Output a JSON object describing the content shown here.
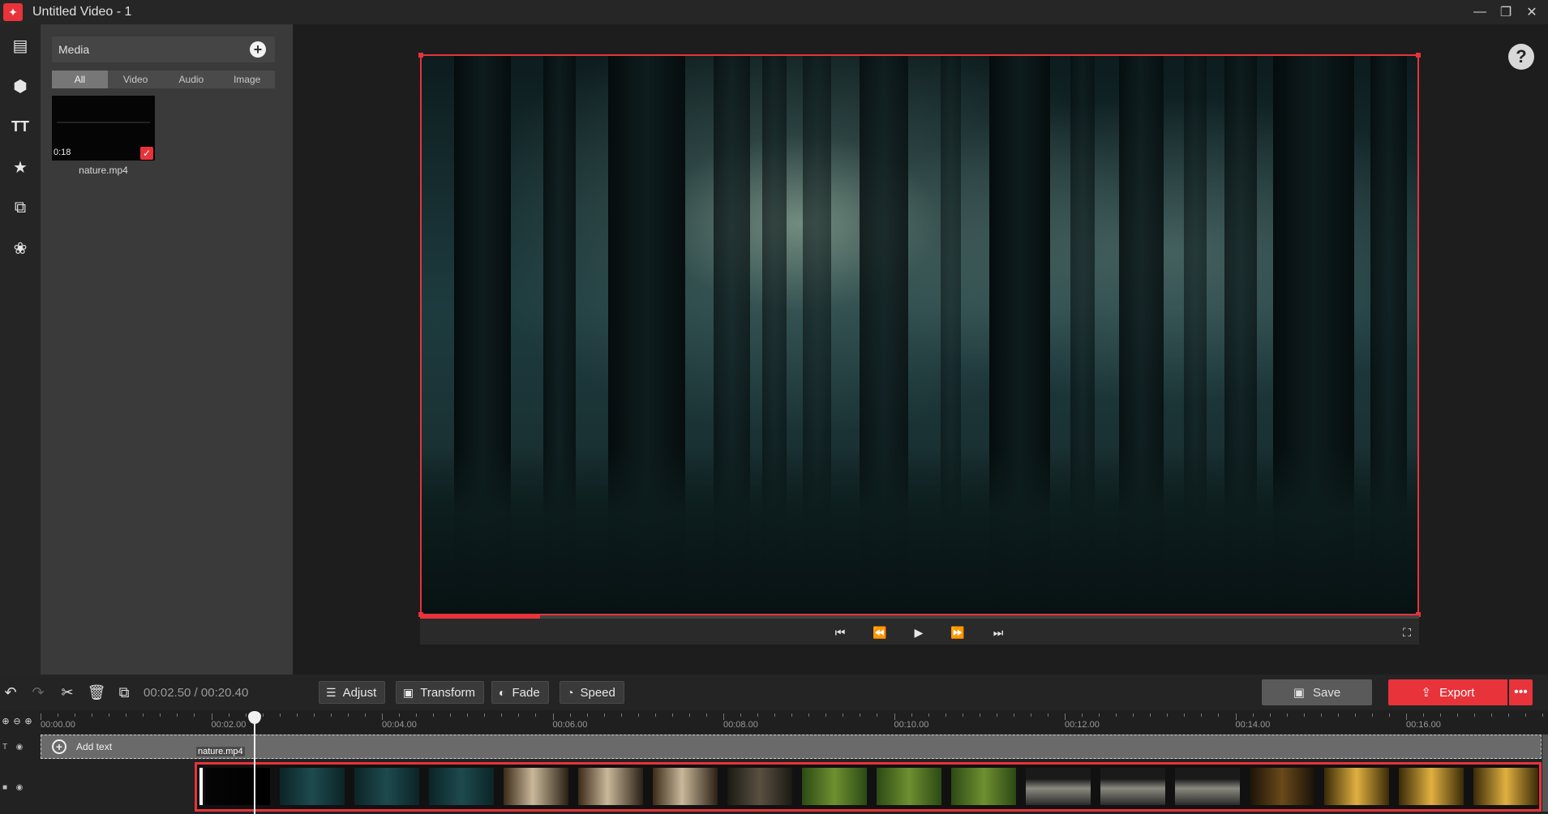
{
  "window": {
    "title": "Untitled Video - 1",
    "min_icon": "minimize-icon",
    "max_icon": "restore-icon",
    "close_icon": "close-icon"
  },
  "rail": {
    "items": [
      "media-icon",
      "shapes-icon",
      "text-icon",
      "effects-icon",
      "transitions-icon",
      "filters-icon"
    ]
  },
  "media": {
    "title": "Media",
    "tabs": [
      {
        "label": "All",
        "active": true
      },
      {
        "label": "Video",
        "active": false
      },
      {
        "label": "Audio",
        "active": false
      },
      {
        "label": "Image",
        "active": false
      }
    ],
    "items": [
      {
        "name": "nature.mp4",
        "duration": "0:18",
        "selected": true
      }
    ]
  },
  "preview": {
    "progress": 0.12
  },
  "toolbar": {
    "timecode": "00:02.50 / 00:20.40",
    "adjust": "Adjust",
    "transform": "Transform",
    "fade": "Fade",
    "speed": "Speed",
    "save": "Save",
    "export": "Export"
  },
  "timeline": {
    "ticks": [
      "00:00.00",
      "00:02.00",
      "00:04.00",
      "00:06.00",
      "00:08.00",
      "00:10.00",
      "00:12.00",
      "00:14.00",
      "00:16.00"
    ],
    "add_text": "Add text",
    "clip_name": "nature.mp4",
    "playhead_time": "00:02.50"
  },
  "colors": {
    "accent": "#e8333a"
  }
}
